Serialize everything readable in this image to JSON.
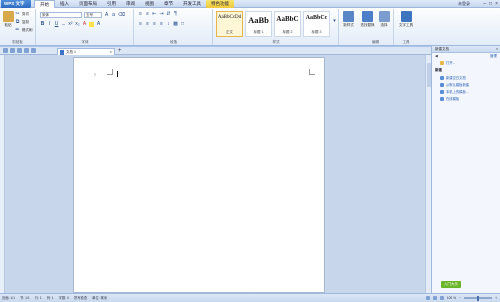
{
  "app": {
    "name": "WPS 文字",
    "version": "未登录"
  },
  "menu": {
    "tabs": [
      "开始",
      "插入",
      "页面布局",
      "引用",
      "审阅",
      "视图",
      "章节",
      "开发工具",
      "特色功能"
    ],
    "active_index": 0
  },
  "ribbon": {
    "clipboard": {
      "paste": "粘贴",
      "cut": "剪切",
      "copy": "复制",
      "format_painter": "格式刷",
      "label": "剪贴板"
    },
    "font": {
      "name": "宋体",
      "size": "五号",
      "label": "字体",
      "bold": "B",
      "italic": "I",
      "underline": "U"
    },
    "paragraph": {
      "label": "段落"
    },
    "styles": {
      "items": [
        {
          "sample": "AaBbCcDd",
          "label": "正文"
        },
        {
          "sample": "AaBb",
          "label": "标题 1"
        },
        {
          "sample": "AaBbC",
          "label": "标题 2"
        },
        {
          "sample": "AaBbCc",
          "label": "标题 3"
        }
      ],
      "new_style": "新样式",
      "label": "样式"
    },
    "editing": {
      "find_replace": "查找替换",
      "select": "选择",
      "label": "编辑"
    },
    "tools": {
      "text_tools": "文字工具",
      "label": "工具"
    }
  },
  "tabs": {
    "document": "文档 1"
  },
  "taskpane": {
    "title": "新建文档",
    "nav_manage": "管理",
    "open": "打开...",
    "section": "新建",
    "items": [
      "新建空白文档",
      "从默认模板新建",
      "本机上的模板...",
      "在线模板"
    ]
  },
  "status": {
    "page": "页面: 1/1",
    "section": "节: 1/1",
    "row": "行: 1",
    "column": "列: 1",
    "words": "字数: 0",
    "spell": "拼写检查",
    "unit": "单位: 毫米",
    "zoom": "100 %",
    "green_button": "入门大乐"
  },
  "colors": {
    "accent": "#2d6cc0",
    "workspace": "#c7d6ea",
    "page": "#ffffff"
  }
}
